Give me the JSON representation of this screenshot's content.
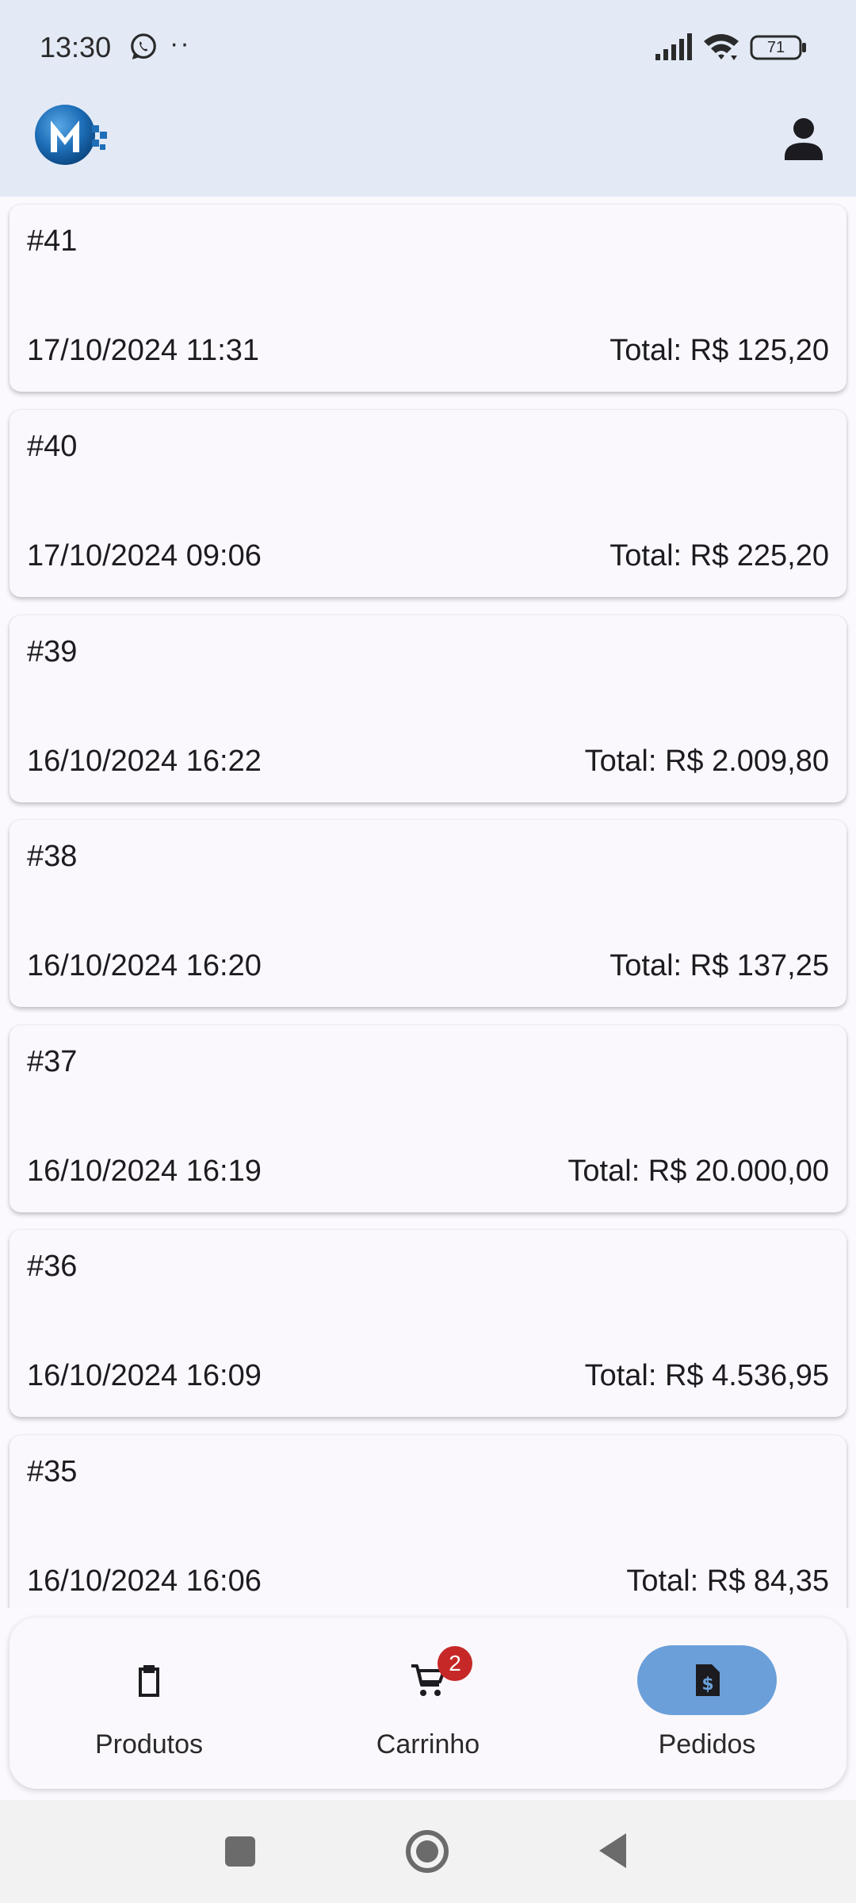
{
  "status_bar": {
    "time": "13:30",
    "notification_icons": [
      "whatsapp-icon",
      "more-dots-icon"
    ],
    "dots": "··",
    "battery_level": "71",
    "system_icons": [
      "signal-icon",
      "wifi-icon",
      "battery-icon"
    ]
  },
  "app_bar": {
    "logo_icon": "app-logo-icon",
    "profile_icon": "person-icon"
  },
  "orders": [
    {
      "id": "#41",
      "date": "17/10/2024 11:31",
      "total": "Total: R$ 125,20"
    },
    {
      "id": "#40",
      "date": "17/10/2024 09:06",
      "total": "Total: R$ 225,20"
    },
    {
      "id": "#39",
      "date": "16/10/2024 16:22",
      "total": "Total: R$ 2.009,80"
    },
    {
      "id": "#38",
      "date": "16/10/2024 16:20",
      "total": "Total: R$ 137,25"
    },
    {
      "id": "#37",
      "date": "16/10/2024 16:19",
      "total": "Total: R$ 20.000,00"
    },
    {
      "id": "#36",
      "date": "16/10/2024 16:09",
      "total": "Total: R$ 4.536,95"
    },
    {
      "id": "#35",
      "date": "16/10/2024 16:06",
      "total": "Total: R$ 84,35"
    }
  ],
  "bottom_nav": {
    "items": [
      {
        "label": "Produtos",
        "icon": "clipboard-icon",
        "active": false
      },
      {
        "label": "Carrinho",
        "icon": "cart-icon",
        "active": false,
        "badge": "2"
      },
      {
        "label": "Pedidos",
        "icon": "invoice-dollar-icon",
        "active": true
      }
    ],
    "active_color": "#6a9fd9",
    "badge_color": "#c62828"
  },
  "system_nav": {
    "buttons": [
      "recents-icon",
      "home-icon",
      "back-icon"
    ]
  }
}
